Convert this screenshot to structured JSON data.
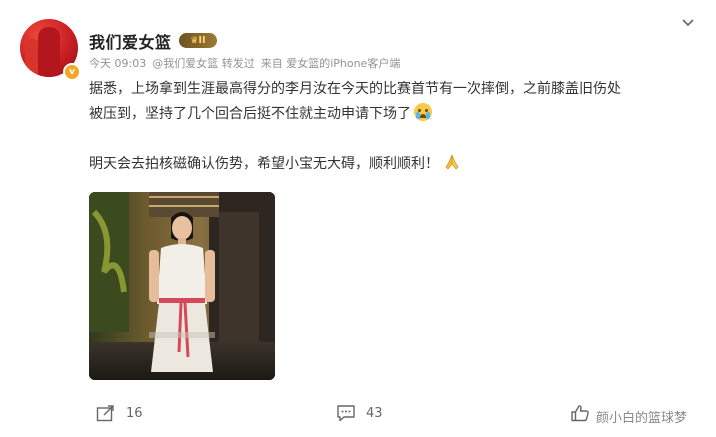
{
  "user": {
    "name": "我们爱女篮",
    "level_badge": "II",
    "verified_badge": "v"
  },
  "meta": {
    "time": "今天 09:03",
    "repost_from": "@我们爱女篮 转发过",
    "source": "来自 爱女篮的iPhone客户端"
  },
  "post": {
    "paragraph1": "据悉，上场拿到生涯最高得分的李月汝在今天的比赛首节有一次摔倒，之前膝盖旧伤处",
    "paragraph1b": "被压到，坚持了几个回合后挺不住就主动申请下场了",
    "paragraph2": "明天会去拍核磁确认伤势，希望小宝无大碍，顺利顺利！"
  },
  "icons": {
    "crying": "crying-emoji",
    "pray": "pray-emoji",
    "more": "chevron-down-icon",
    "share": "share-icon",
    "comment": "comment-icon",
    "like": "like-icon"
  },
  "actions": {
    "share_count": "16",
    "comment_count": "43"
  },
  "watermark": "颜小白的篮球梦",
  "colors": {
    "accent": "#ff8200",
    "meta": "#939393"
  }
}
